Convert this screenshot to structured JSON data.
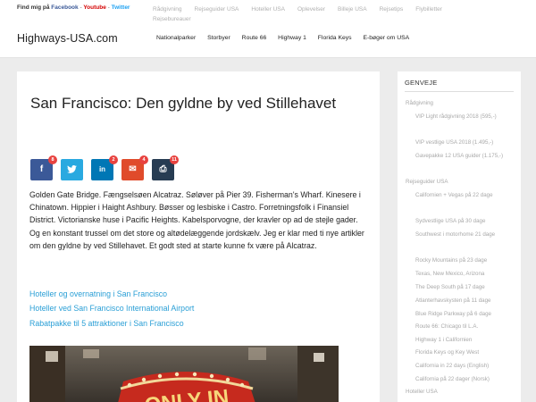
{
  "topbar": {
    "follow_prefix": "Find mig på",
    "facebook": "Facebook",
    "sep1": "-",
    "youtube": "Youtube",
    "sep2": "-",
    "twitter": "Twitter",
    "links": [
      "Rådgivning",
      "Rejseguider USA",
      "Hoteller USA",
      "Oplevelser",
      "Billeje USA",
      "Rejsetips",
      "Flybilletter",
      "Rejsebureauer"
    ]
  },
  "header": {
    "logo": "Highways-USA.com",
    "nav": [
      "Nationalparker",
      "Storbyer",
      "Route 66",
      "Highway 1",
      "Florida Keys",
      "E-bøger om USA"
    ]
  },
  "article": {
    "title": "San Francisco: Den gyldne by ved Stillehavet",
    "shares": [
      {
        "icon": "f",
        "count": "8"
      },
      {
        "icon": "t",
        "count": ""
      },
      {
        "icon": "in",
        "count": "2"
      },
      {
        "icon": "✉",
        "count": "4"
      },
      {
        "icon": "⎙",
        "count": "11"
      }
    ],
    "body": "Golden Gate Bridge. Fængselsøen Alcatraz. Søløver på Pier 39. Fisherman's Wharf. Kinesere i Chinatown. Hippier i Haight Ashbury. Bøsser og lesbiske i Castro. Forretningsfolk i Finansiel District. Victorianske huse i Pacific Heights. Kabelsporvogne, der kravler op ad de stejle gader. Og en konstant trussel om det store og altødelæggende jordskælv. Jeg er klar med ti nye artikler om den gyldne by ved Stillehavet. Et godt sted at starte kunne fx være på Alcatraz.",
    "links": [
      "Hoteller og overnatning i San Francisco",
      "Hoteller ved San Francisco International Airport",
      "Rabatpakke til 5 attraktioner i San Francisco"
    ],
    "image_sign_text": "ONLY IN"
  },
  "sidebar": {
    "title": "GENVEJE",
    "items": [
      {
        "text": "Rådgivning",
        "level": 0
      },
      {
        "text": "VIP Light rådgivning 2018 (595,-)",
        "level": 1
      },
      {
        "text": "VIP vestlige USA 2018 (1.495,-)",
        "level": 1
      },
      {
        "text": "Gavepakke 12 USA guider (1.175,-)",
        "level": 1
      },
      {
        "text": "Rejseguider USA",
        "level": 0
      },
      {
        "text": "Californien + Vegas på 22 dage",
        "level": 1
      },
      {
        "text": "Sydvestlige USA på 30 dage",
        "level": 1
      },
      {
        "text": "Southwest i motorhome 21 dage",
        "level": 1
      },
      {
        "text": "Rocky Mountains på 23 dage",
        "level": 1
      },
      {
        "text": "Texas, New Mexico, Arizona",
        "level": 1
      },
      {
        "text": "The Deep South på 17 dage",
        "level": 1
      },
      {
        "text": "Atlanterhavskysten på 11 dage",
        "level": 1
      },
      {
        "text": "Blue Ridge Parkway på 6 dage",
        "level": 1
      },
      {
        "text": "Route 66: Chicago til L.A.",
        "level": 1
      },
      {
        "text": "Highway 1 i Californien",
        "level": 1
      },
      {
        "text": "Florida Keys og Key West",
        "level": 1
      },
      {
        "text": "California in 22 days (English)",
        "level": 1
      },
      {
        "text": "California på 22 dager (Norsk)",
        "level": 1
      },
      {
        "text": "Hoteller USA",
        "level": 0
      }
    ]
  }
}
